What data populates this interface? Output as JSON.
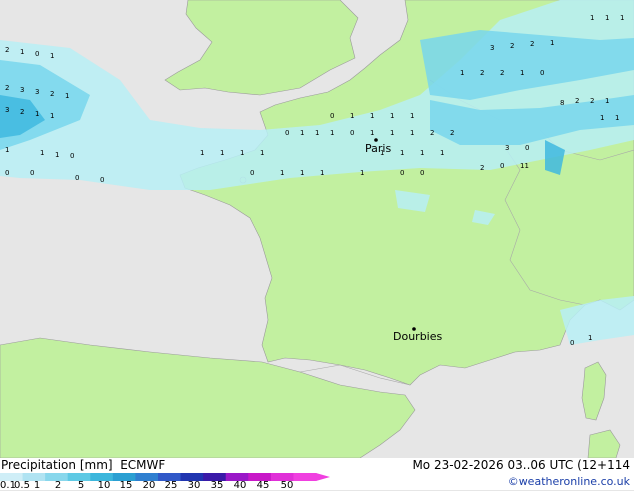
{
  "title": {
    "product": "Precipitation [mm]",
    "model": "ECMWF",
    "datetime": "Mo 23-02-2026 03..06 UTC (12+114",
    "credit": "©weatheronline.co.uk"
  },
  "legend": {
    "ticks": [
      "0.1",
      "0.5",
      "1",
      "2",
      "5",
      "10",
      "15",
      "20",
      "25",
      "30",
      "35",
      "40",
      "45",
      "50"
    ],
    "colors": [
      "#cfeef7",
      "#b0e3f2",
      "#88d7ec",
      "#5ec9e4",
      "#3cb6dc",
      "#2a9fd2",
      "#2f7fd0",
      "#3058c8",
      "#2035b0",
      "#3a1aa8",
      "#9a18c8",
      "#c818c8",
      "#e030d8",
      "#f040e0"
    ]
  },
  "cities": [
    {
      "name": "Paris"
    },
    {
      "name": "Dourbies"
    }
  ],
  "colors": {
    "sea": "#e6e6e6",
    "land": "#c2f0a0",
    "precip_light": "#b7eef5",
    "precip_med": "#78d6ec",
    "precip_heavy": "#3fb8df"
  }
}
